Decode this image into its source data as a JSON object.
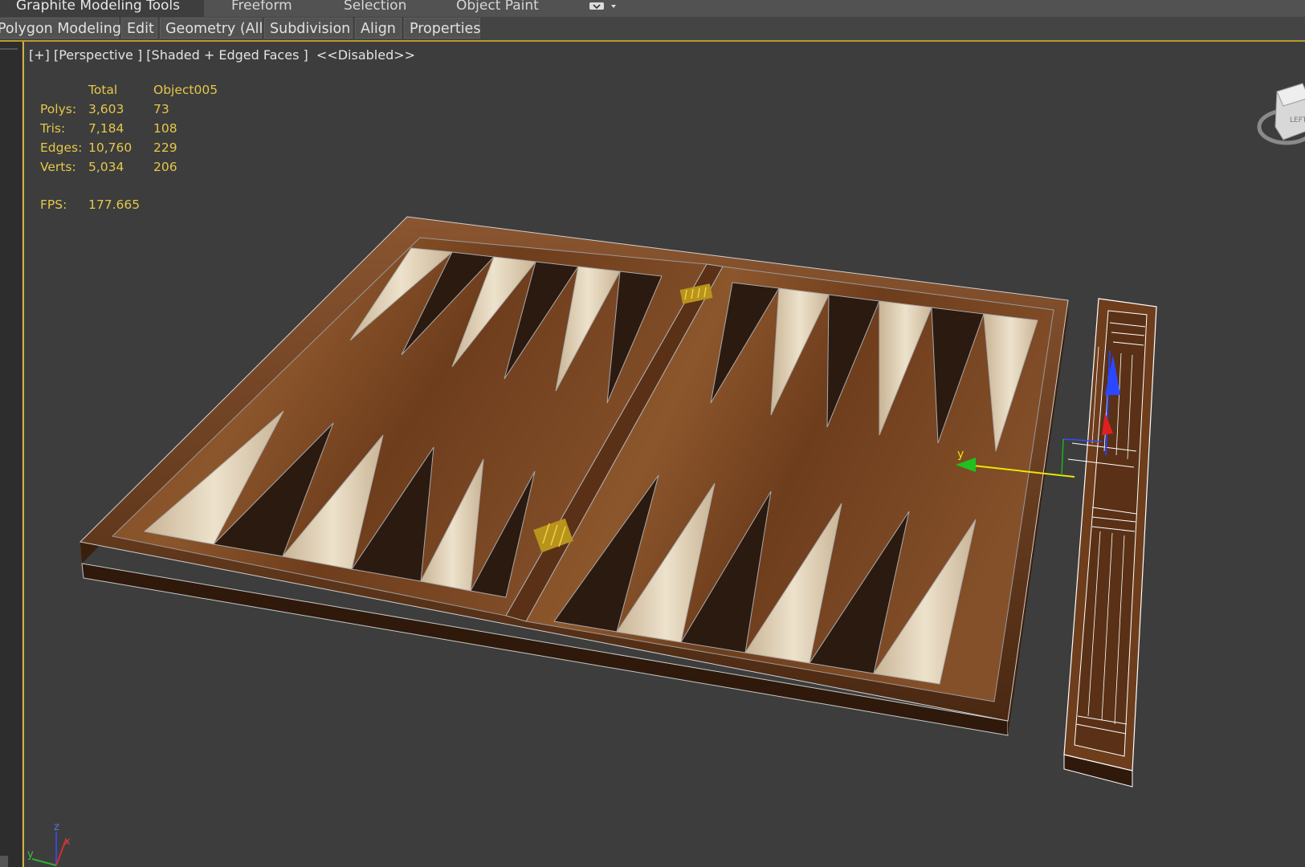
{
  "ribbon": {
    "tabs": [
      "Graphite Modeling Tools",
      "Freeform",
      "Selection",
      "Object Paint"
    ],
    "panels": [
      "Polygon Modeling",
      "Edit",
      "Geometry (All)",
      "Subdivision",
      "Align",
      "Properties"
    ]
  },
  "viewport": {
    "label": "[+] [Perspective ] [Shaded + Edged Faces ]  <<Disabled>>",
    "stats": {
      "header_total": "Total",
      "header_object": "Object005",
      "rows": [
        {
          "label": "Polys:",
          "total": "3,603",
          "object": "73"
        },
        {
          "label": "Tris:",
          "total": "7,184",
          "object": "108"
        },
        {
          "label": "Edges:",
          "total": "10,760",
          "object": "229"
        },
        {
          "label": "Verts:",
          "total": "5,034",
          "object": "206"
        }
      ],
      "fps_label": "FPS:",
      "fps_value": "177.665"
    },
    "gizmo": {
      "y_label": "y"
    },
    "axis_tripod": {
      "z": "z",
      "x": "x",
      "y": "y"
    },
    "viewcube_face": "LEFT"
  },
  "colors": {
    "accent": "#d7b13f",
    "stat_text": "#e4c84a",
    "viewport_bg": "#3d3d3d",
    "wood": "#6e3d1c",
    "point_light": "#e6d8bf",
    "point_dark": "#2b1a10"
  }
}
